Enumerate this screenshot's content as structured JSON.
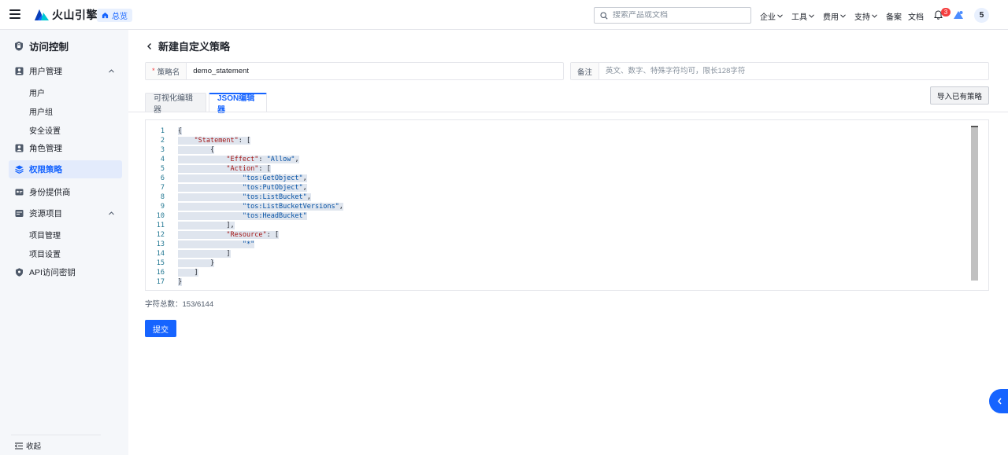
{
  "topbar": {
    "brand": "火山引擎",
    "overview_label": "总览",
    "search_placeholder": "搜索产品或文档",
    "nav": [
      {
        "label": "企业",
        "dropdown": true
      },
      {
        "label": "工具",
        "dropdown": true
      },
      {
        "label": "费用",
        "dropdown": true
      },
      {
        "label": "支持",
        "dropdown": true
      },
      {
        "label": "备案",
        "dropdown": false
      },
      {
        "label": "文档",
        "dropdown": false
      }
    ],
    "notification_count": "3",
    "avatar_label": "5"
  },
  "sidebar": {
    "title": "访问控制",
    "items": [
      {
        "label": "用户管理",
        "icon": "user-icon",
        "expandable": true
      },
      {
        "label": "用户",
        "sub": true
      },
      {
        "label": "用户组",
        "sub": true
      },
      {
        "label": "安全设置",
        "sub": true
      },
      {
        "label": "角色管理",
        "icon": "role-icon"
      },
      {
        "label": "权限策略",
        "icon": "policy-icon",
        "active": true
      },
      {
        "label": "身份提供商",
        "icon": "idp-icon"
      },
      {
        "label": "资源项目",
        "icon": "project-icon",
        "expandable": true
      },
      {
        "label": "项目管理",
        "sub": true
      },
      {
        "label": "项目设置",
        "sub": true
      },
      {
        "label": "API访问密钥",
        "icon": "shield-icon"
      }
    ],
    "collapse_label": "收起"
  },
  "page": {
    "title": "新建自定义策略",
    "policy_name_label": "策略名",
    "policy_name_value": "demo_statement",
    "remark_label": "备注",
    "remark_placeholder": "英文、数字、特殊字符均可，限长128字符",
    "tabs": [
      "可视化编辑器",
      "JSON编辑器"
    ],
    "active_tab": "JSON编辑器",
    "import_button": "导入已有策略",
    "char_count": "字符总数：153/6144",
    "submit_button": "提交"
  },
  "editor": {
    "lines": [
      {
        "n": "1",
        "indent": 0,
        "parts": [
          {
            "t": "p",
            "v": "{"
          }
        ]
      },
      {
        "n": "2",
        "indent": 1,
        "parts": [
          {
            "t": "k",
            "v": "\"Statement\""
          },
          {
            "t": "p",
            "v": ": ["
          }
        ]
      },
      {
        "n": "3",
        "indent": 2,
        "parts": [
          {
            "t": "p",
            "v": "{"
          }
        ]
      },
      {
        "n": "4",
        "indent": 3,
        "parts": [
          {
            "t": "k",
            "v": "\"Effect\""
          },
          {
            "t": "p",
            "v": ": "
          },
          {
            "t": "s",
            "v": "\"Allow\""
          },
          {
            "t": "p",
            "v": ","
          }
        ]
      },
      {
        "n": "5",
        "indent": 3,
        "parts": [
          {
            "t": "k",
            "v": "\"Action\""
          },
          {
            "t": "p",
            "v": ": ["
          }
        ]
      },
      {
        "n": "6",
        "indent": 4,
        "parts": [
          {
            "t": "s",
            "v": "\"tos:GetObject\""
          },
          {
            "t": "p",
            "v": ","
          }
        ]
      },
      {
        "n": "7",
        "indent": 4,
        "parts": [
          {
            "t": "s",
            "v": "\"tos:PutObject\""
          },
          {
            "t": "p",
            "v": ","
          }
        ]
      },
      {
        "n": "8",
        "indent": 4,
        "parts": [
          {
            "t": "s",
            "v": "\"tos:ListBucket\""
          },
          {
            "t": "p",
            "v": ","
          }
        ]
      },
      {
        "n": "9",
        "indent": 4,
        "parts": [
          {
            "t": "s",
            "v": "\"tos:ListBucketVersions\""
          },
          {
            "t": "p",
            "v": ","
          }
        ]
      },
      {
        "n": "10",
        "indent": 4,
        "parts": [
          {
            "t": "s",
            "v": "\"tos:HeadBucket\""
          }
        ]
      },
      {
        "n": "11",
        "indent": 3,
        "parts": [
          {
            "t": "p",
            "v": "],"
          }
        ]
      },
      {
        "n": "12",
        "indent": 3,
        "parts": [
          {
            "t": "k",
            "v": "\"Resource\""
          },
          {
            "t": "p",
            "v": ": ["
          }
        ]
      },
      {
        "n": "13",
        "indent": 4,
        "parts": [
          {
            "t": "s",
            "v": "\"*\""
          }
        ]
      },
      {
        "n": "14",
        "indent": 3,
        "parts": [
          {
            "t": "p",
            "v": "]"
          }
        ]
      },
      {
        "n": "15",
        "indent": 2,
        "parts": [
          {
            "t": "p",
            "v": "}"
          }
        ]
      },
      {
        "n": "16",
        "indent": 1,
        "parts": [
          {
            "t": "p",
            "v": "]"
          }
        ]
      },
      {
        "n": "17",
        "indent": 0,
        "parts": [
          {
            "t": "p",
            "v": "}"
          }
        ]
      }
    ]
  },
  "colors": {
    "accent": "#1664ff",
    "sidebar_bg": "#f5f7fa",
    "active_bg": "#e3ebfc",
    "json_key": "#a31515",
    "json_string": "#0451a5"
  }
}
